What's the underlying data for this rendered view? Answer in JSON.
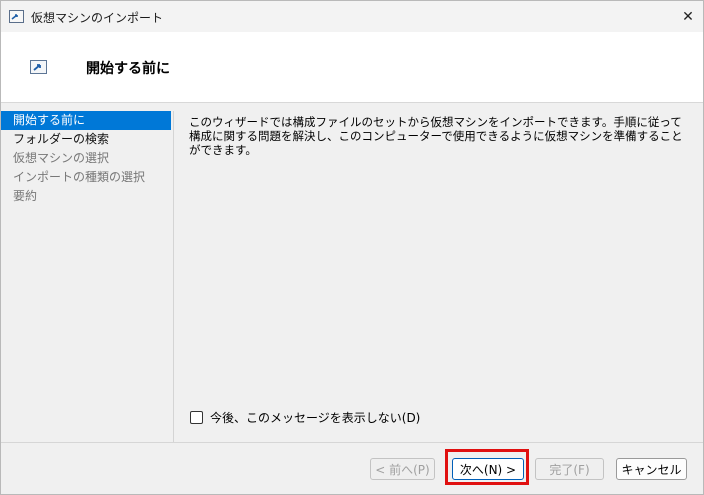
{
  "window": {
    "title": "仮想マシンのインポート",
    "close_glyph": "✕"
  },
  "header": {
    "title": "開始する前に"
  },
  "sidebar": {
    "items": [
      {
        "label": "開始する前に"
      },
      {
        "label": "フォルダーの検索"
      },
      {
        "label": "仮想マシンの選択"
      },
      {
        "label": "インポートの種類の選択"
      },
      {
        "label": "要約"
      }
    ]
  },
  "content": {
    "description": "このウィザードでは構成ファイルのセットから仮想マシンをインポートできます。手順に従って構成に関する問題を解決し、このコンピューターで使用できるように仮想マシンを準備することができます。"
  },
  "options": {
    "dont_show_label": "今後、このメッセージを表示しない(D)"
  },
  "buttons": {
    "back": "< 前へ(P)",
    "next": "次へ(N) >",
    "finish": "完了(F)",
    "cancel": "キャンセル"
  },
  "colors": {
    "selection": "#0078d7",
    "highlight_box": "#e01010"
  }
}
